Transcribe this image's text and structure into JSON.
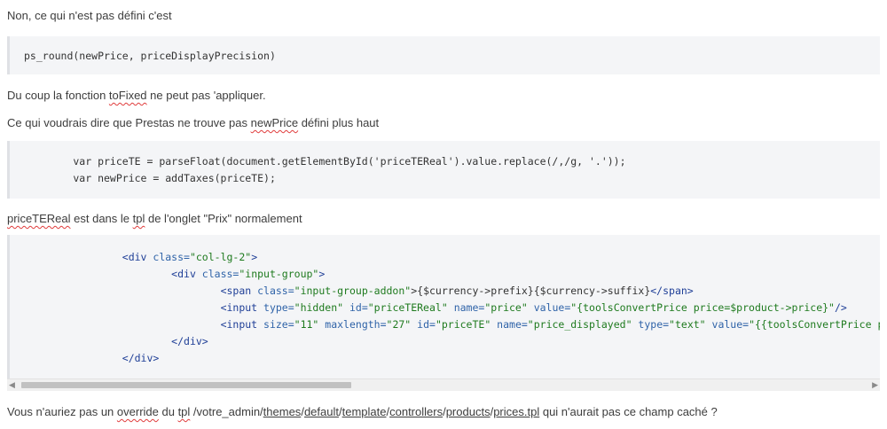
{
  "para1": "Non, ce qui n'est pas défini c'est",
  "code1": "ps_round(newPrice, priceDisplayPrecision)",
  "para2": {
    "before": "Du coup la fonction ",
    "word": "toFixed",
    "after": " ne peut pas 'appliquer."
  },
  "para3": {
    "before": "Ce qui voudrais dire que Prestas ne trouve pas ",
    "word": "newPrice",
    "after": " défini plus haut"
  },
  "code2": {
    "line1": "        var priceTE = parseFloat(document.getElementById('priceTEReal').value.replace(/,/g, '.'));",
    "line2": "        var newPrice = addTaxes(priceTE);"
  },
  "para4": {
    "word1": "priceTEReal",
    "middle1": " est dans le ",
    "word2": "tpl",
    "after": " de l'onglet \"Prix\" normalement"
  },
  "code3": {
    "indent1": "                ",
    "indent2": "                        ",
    "indent3": "                                ",
    "l1_tag": "<div",
    "l1_attr": " class=",
    "l1_val": "\"col-lg-2\"",
    "l1_end": ">",
    "l2_tag": "<div",
    "l2_attr": " class=",
    "l2_val": "\"input-group\"",
    "l2_end": ">",
    "l3_tag": "<span",
    "l3_attr": " class=",
    "l3_val": "\"input-group-addon\"",
    "l3_mid": ">{$currency->prefix}{$currency->suffix}",
    "l3_end": "</span>",
    "l4_tag": "<input",
    "l4_a1": " type=",
    "l4_v1": "\"hidden\"",
    "l4_a2": " id=",
    "l4_v2": "\"priceTEReal\"",
    "l4_a3": " name=",
    "l4_v3": "\"price\"",
    "l4_a4": " value=",
    "l4_v4": "\"{toolsConvertPrice price=$product->price}\"",
    "l4_end": "/>",
    "l5_tag": "<input",
    "l5_a1": " size=",
    "l5_v1": "\"11\"",
    "l5_a2": " maxlength=",
    "l5_v2": "\"27\"",
    "l5_a3": " id=",
    "l5_v3": "\"priceTE\"",
    "l5_a4": " name=",
    "l5_v4": "\"price_displayed\"",
    "l5_a5": " type=",
    "l5_v5": "\"text\"",
    "l5_a6": " value=",
    "l5_v6": "\"{{toolsConvertPrice price=$product->price}|string_format:$priceDisplayPrecisionFormat}\"",
    "l6_tag": "</div>",
    "l7_tag": "</div>"
  },
  "para5": {
    "before": "Vous n'auriez pas un ",
    "w_override": "override",
    "t1": " du ",
    "w_tpl": "tpl",
    "t2": "  /votre_admin/",
    "w_themes": "themes",
    "s1": "/",
    "w_default": "default",
    "s2": "/",
    "w_template": "template",
    "s3": "/",
    "w_controllers": "controllers",
    "s4": "/",
    "w_products": "products",
    "s5": "/",
    "w_prices": "prices.tpl",
    "after": "  qui n'aurait pas ce champ caché ?"
  }
}
